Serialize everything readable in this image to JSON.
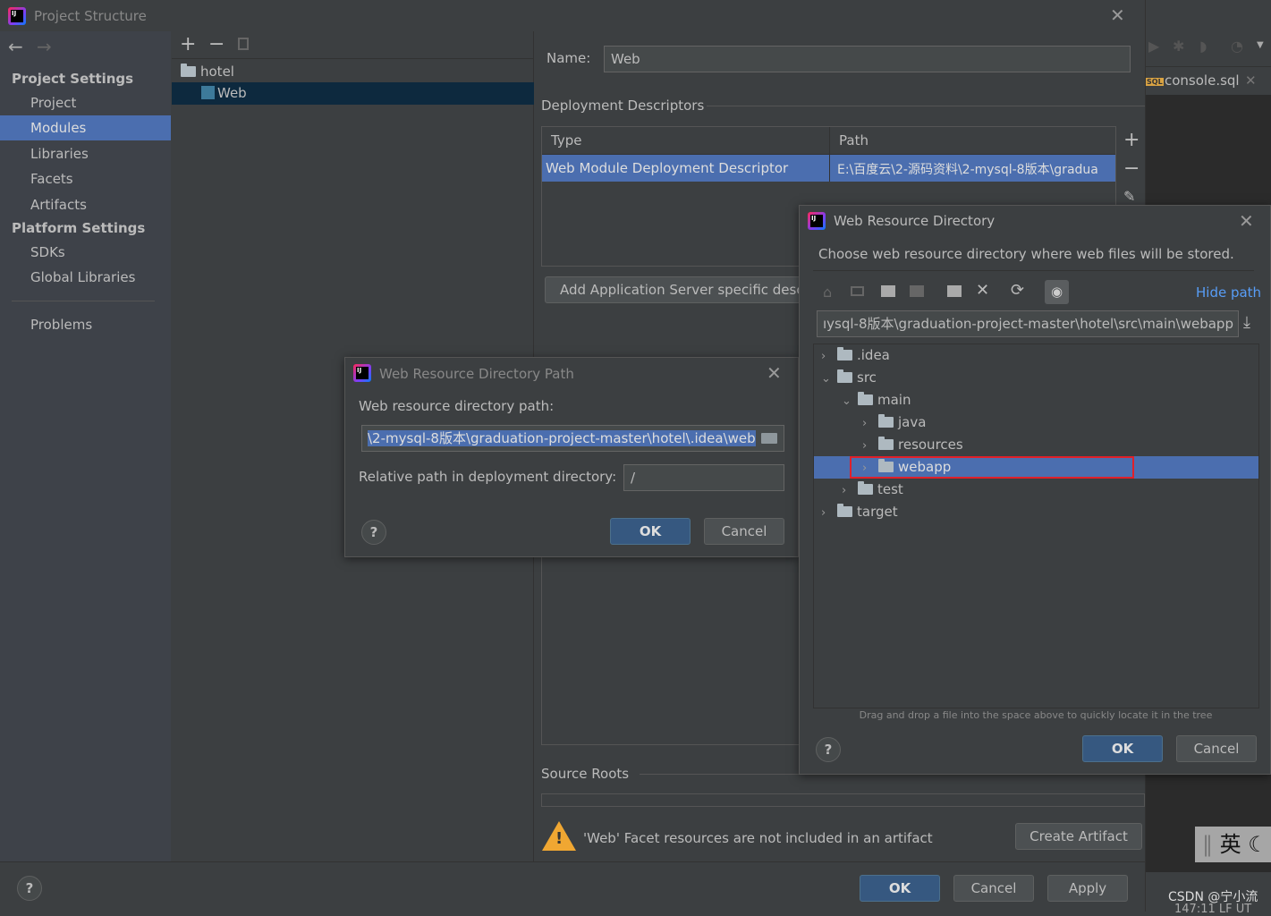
{
  "window": {
    "title": "Project Structure",
    "close_icon": "close-icon"
  },
  "sidebar": {
    "section1": "Project Settings",
    "items1": [
      "Project",
      "Modules",
      "Libraries",
      "Facets",
      "Artifacts"
    ],
    "section2": "Platform Settings",
    "items2": [
      "SDKs",
      "Global Libraries"
    ],
    "problems": "Problems",
    "selected": "Modules"
  },
  "modules_tree": {
    "items": [
      {
        "label": "hotel"
      },
      {
        "label": "Web",
        "selected": true
      }
    ]
  },
  "module": {
    "name_label": "Name:",
    "name_value": "Web",
    "deployment_title": "Deployment Descriptors",
    "columns": [
      "Type",
      "Path"
    ],
    "rows": [
      {
        "type": "Web Module Deployment Descriptor",
        "path": "E:\\百度云\\2-源码资料\\2-mysql-8版本\\gradua"
      }
    ],
    "add_server_button": "Add Application Server specific desc",
    "source_roots_title": "Source Roots",
    "warning": "'Web' Facet resources are not included in an artifact",
    "create_artifact": "Create Artifact"
  },
  "footer": {
    "ok": "OK",
    "cancel": "Cancel",
    "apply": "Apply"
  },
  "editor": {
    "tab": "console.sql",
    "tab_badge": "SQL",
    "ime": "英",
    "watermark": "CSDN @宁小流",
    "status": "147:11  LF  UT"
  },
  "path_dialog": {
    "title": "Web Resource Directory Path",
    "path_label": "Web resource directory path:",
    "path_value": "\\2-mysql-8版本\\graduation-project-master\\hotel\\.idea\\web",
    "relative_label": "Relative path in deployment directory:",
    "relative_value": "/",
    "ok": "OK",
    "cancel": "Cancel"
  },
  "dir_dialog": {
    "title": "Web Resource Directory",
    "description": "Choose web resource directory where web files will be stored.",
    "hide_path": "Hide path",
    "path_value": "ıysql-8版本\\graduation-project-master\\hotel\\src\\main\\webapp",
    "tree": [
      {
        "label": ".idea",
        "depth": 0,
        "expanded": false
      },
      {
        "label": "src",
        "depth": 0,
        "expanded": true
      },
      {
        "label": "main",
        "depth": 1,
        "expanded": true
      },
      {
        "label": "java",
        "depth": 2,
        "expanded": false
      },
      {
        "label": "resources",
        "depth": 2,
        "expanded": false
      },
      {
        "label": "webapp",
        "depth": 2,
        "expanded": false,
        "selected": true
      },
      {
        "label": "test",
        "depth": 1,
        "expanded": false
      },
      {
        "label": "target",
        "depth": 0,
        "expanded": false
      }
    ],
    "hint": "Drag and drop a file into the space above to quickly locate it in the tree",
    "ok": "OK",
    "cancel": "Cancel"
  },
  "colors": {
    "selection": "#4b6eaf",
    "tree_selection": "#0d293e",
    "link": "#589df6",
    "highlight_box": "#e0202a",
    "ok_button": "#365880"
  }
}
